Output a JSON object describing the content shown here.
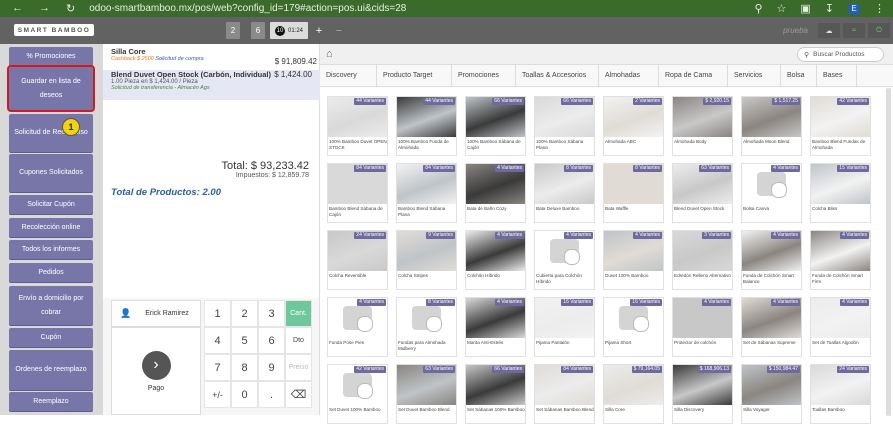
{
  "browser": {
    "url": "odoo-smartbamboo.mx/pos/web?config_id=179#action=pos.ui&cids=28",
    "profile_initial": "E"
  },
  "header": {
    "logo_text": "SMART BAMBOO",
    "tabs": [
      {
        "label": "2"
      },
      {
        "label": "6"
      },
      {
        "number": "10",
        "time": "01:24"
      }
    ],
    "add_label": "+",
    "remove_label": "−",
    "user_label": "prueba"
  },
  "leftbar": {
    "buttons": [
      {
        "label": "% Promociones"
      },
      {
        "label": "Guardar en lista de deseos"
      },
      {
        "label": "Solicitud de Reembolso"
      },
      {
        "label": "Cupones Solicitados"
      },
      {
        "label": "Solicitar Cupón"
      },
      {
        "label": "Recolección online"
      },
      {
        "label": "Todos los informes"
      },
      {
        "label": "Pedidos"
      },
      {
        "label": "Envío a domicilio por cobrar"
      },
      {
        "label": "Cupón"
      },
      {
        "label": "Ordenes de reemplazo"
      },
      {
        "label": "Reemplazo"
      }
    ],
    "marker": "1"
  },
  "order": {
    "lines": [
      {
        "name": "Silla Core",
        "price": "$ 91,809.42",
        "note": "Cashback $ 2500",
        "note2": "Solicitud de compra"
      },
      {
        "name": "Blend Duvet Open Stock (Carbón, Individual)",
        "price": "$ 1,424.00",
        "qty": "1.00 Pieza en $ 1,424.00 / Pieza",
        "transfer": "Solicitud de transferencia - Almacén Ags"
      }
    ],
    "total": "Total: $ 93,233.42",
    "taxes": "Impuestos: $ 12,859.78",
    "total_products": "Total de Productos: 2.00"
  },
  "pad": {
    "customer": "Erick Ramirez",
    "pay": "Pago",
    "keys": [
      "1",
      "2",
      "3",
      "Cant.",
      "4",
      "5",
      "6",
      "Dto",
      "7",
      "8",
      "9",
      "Precio",
      "+/-",
      "0",
      ".",
      "⌫"
    ]
  },
  "products": {
    "search_placeholder": "Buscar Productos",
    "categories": [
      "Discovery",
      "Producto Target",
      "Promociones",
      "Toallas & Accesorios",
      "Almohadas",
      "Ropa de Cama",
      "Servicios",
      "Bolsa",
      "Bases"
    ],
    "items": [
      {
        "tag": "44 Variantes",
        "name": "100% Bamboo Duvet OPEN STOCK"
      },
      {
        "tag": "44 Variantes",
        "name": "100% Bamboo Funda de Almohada"
      },
      {
        "tag": "66 Variantes",
        "name": "100% Bamboo Sábana de Cajón"
      },
      {
        "tag": "66 Variantes",
        "name": "100% Bamboo Sábana Plana"
      },
      {
        "tag": "2 Variantes",
        "name": "Almohada ABC"
      },
      {
        "tag": "$ 2,920.15",
        "name": "Almohada Body"
      },
      {
        "tag": "$ 1,517.25",
        "name": "Almohada Moon Blend"
      },
      {
        "tag": "42 Variantes",
        "name": "Bamboo Blend Fundas de Almohada"
      },
      {
        "tag": "84 Variantes",
        "name": "Bamboo Blend Sábana de Cajón"
      },
      {
        "tag": "84 Variantes",
        "name": "Bamboo Blend Sábana Plana"
      },
      {
        "tag": "4 Variantes",
        "name": "Bata de Baño Cozy"
      },
      {
        "tag": "8 Variantes",
        "name": "Bata Deluxe Bamboo"
      },
      {
        "tag": "8 Variantes",
        "name": "Bata Waffle"
      },
      {
        "tag": "63 Variantes",
        "name": "Blend Duvet Open Stock"
      },
      {
        "tag": "4 Variantes",
        "name": "Bolsa Canva"
      },
      {
        "tag": "15 Variantes",
        "name": "Colcha Bliss"
      },
      {
        "tag": "24 Variantes",
        "name": "Colcha Reversible"
      },
      {
        "tag": "9 Variantes",
        "name": "Colcha Stripes"
      },
      {
        "tag": "4 Variantes",
        "name": "Colchón Híbrido"
      },
      {
        "tag": "4 Variantes",
        "name": "Cubierta para Colchón Híbrido"
      },
      {
        "tag": "4 Variantes",
        "name": "Duvet 100% Bamboo"
      },
      {
        "tag": "3 Variantes",
        "name": "Edredón Relleno Alternativo"
      },
      {
        "tag": "4 Variantes",
        "name": "Funda de Colchón Smart Balance"
      },
      {
        "tag": "4 Variantes",
        "name": "Funda de Colchón Smart Firm"
      },
      {
        "tag": "4 Variantes",
        "name": "Funda Pose Pies"
      },
      {
        "tag": "8 Variantes",
        "name": "Fundas para Almohada Mulberry"
      },
      {
        "tag": "4 Variantes",
        "name": "Manta Anti-Estrés"
      },
      {
        "tag": "16 Variantes",
        "name": "Pijama Pantalón"
      },
      {
        "tag": "16 Variantes",
        "name": "Pijama Short"
      },
      {
        "tag": "4 Variantes",
        "name": "Protector de colchón"
      },
      {
        "tag": "4 Variantes",
        "name": "Set de Sábanas Supreme"
      },
      {
        "tag": "4 Variantes",
        "name": "Set de Toallas Algodón"
      },
      {
        "tag": "42 Variantes",
        "name": "Set Duvet 100% Bamboo"
      },
      {
        "tag": "63 Variantes",
        "name": "Set Duvet Bamboo Blend"
      },
      {
        "tag": "66 Variantes",
        "name": "Set Sábanas 100% Bamboo"
      },
      {
        "tag": "84 Variantes",
        "name": "Set Sábanas Bamboo Blend"
      },
      {
        "tag": "$ 79,164.05",
        "name": "Silla Core"
      },
      {
        "tag": "$ 168,906.13",
        "name": "Silla Discovery"
      },
      {
        "tag": "$ 150,984.47",
        "name": "Silla Voyager"
      },
      {
        "tag": "24 Variantes",
        "name": "Toallas Bamboo"
      }
    ]
  },
  "colors": {
    "accent": "#7876a9",
    "header": "#626262",
    "browser": "#3b6b2a",
    "highlight": "#d61a1a",
    "cant": "#6ec89b"
  }
}
